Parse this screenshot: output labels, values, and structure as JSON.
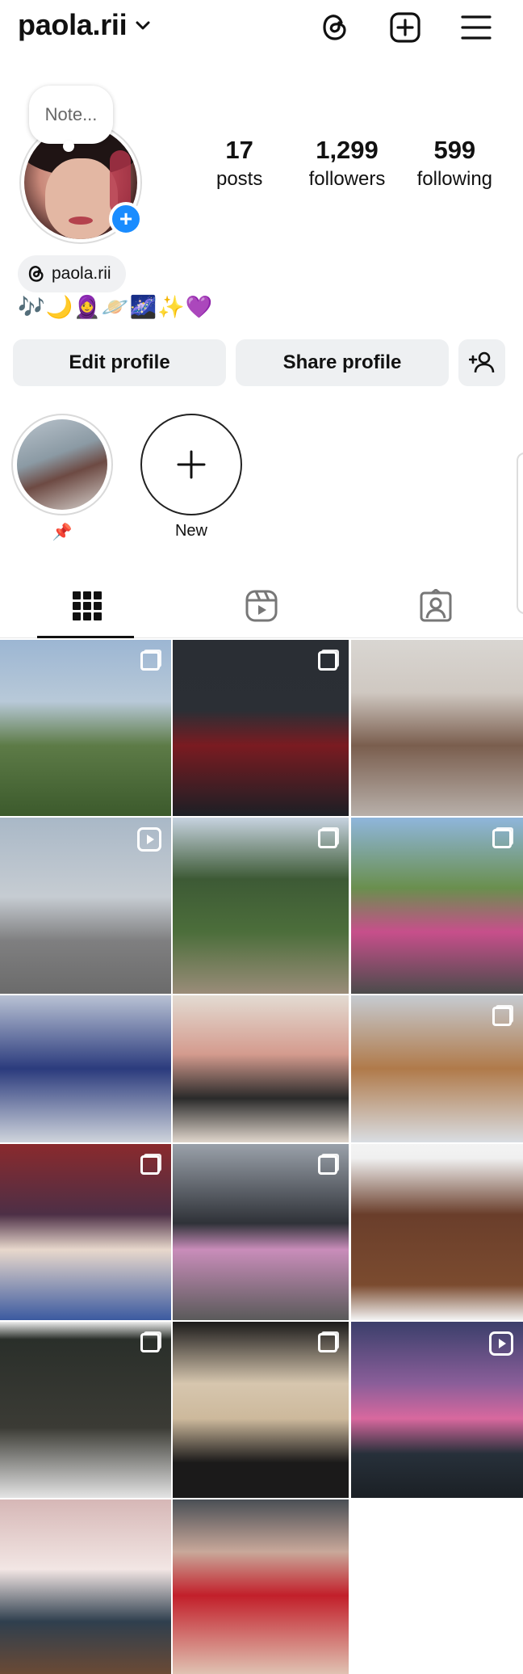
{
  "header": {
    "username": "paola.rii",
    "icons": [
      "threads-icon",
      "new-post-icon",
      "menu-icon"
    ]
  },
  "profile": {
    "note_placeholder": "Note...",
    "stats": [
      {
        "value": "17",
        "label": "posts"
      },
      {
        "value": "1,299",
        "label": "followers"
      },
      {
        "value": "599",
        "label": "following"
      }
    ],
    "threads_handle": "paola.rii",
    "bio": "🎶🌙🧕🪐🌌✨💜"
  },
  "actions": {
    "edit_label": "Edit profile",
    "share_label": "Share profile",
    "discover_icon": "add-person-icon"
  },
  "highlights": [
    {
      "label": "📌"
    },
    {
      "label": "New"
    }
  ],
  "tabs": [
    "grid-icon",
    "reels-icon",
    "tagged-icon"
  ],
  "colors": {
    "accent": "#1a8cff",
    "button_bg": "#eef0f2"
  },
  "posts": [
    {
      "type": "multi"
    },
    {
      "type": "multi"
    },
    {
      "type": "photo"
    },
    {
      "type": "reel"
    },
    {
      "type": "multi"
    },
    {
      "type": "multi"
    },
    {
      "type": "photo"
    },
    {
      "type": "photo"
    },
    {
      "type": "multi"
    },
    {
      "type": "multi"
    },
    {
      "type": "multi"
    },
    {
      "type": "photo"
    },
    {
      "type": "multi"
    },
    {
      "type": "multi"
    },
    {
      "type": "reel"
    },
    {
      "type": "photo"
    },
    {
      "type": "photo"
    }
  ]
}
